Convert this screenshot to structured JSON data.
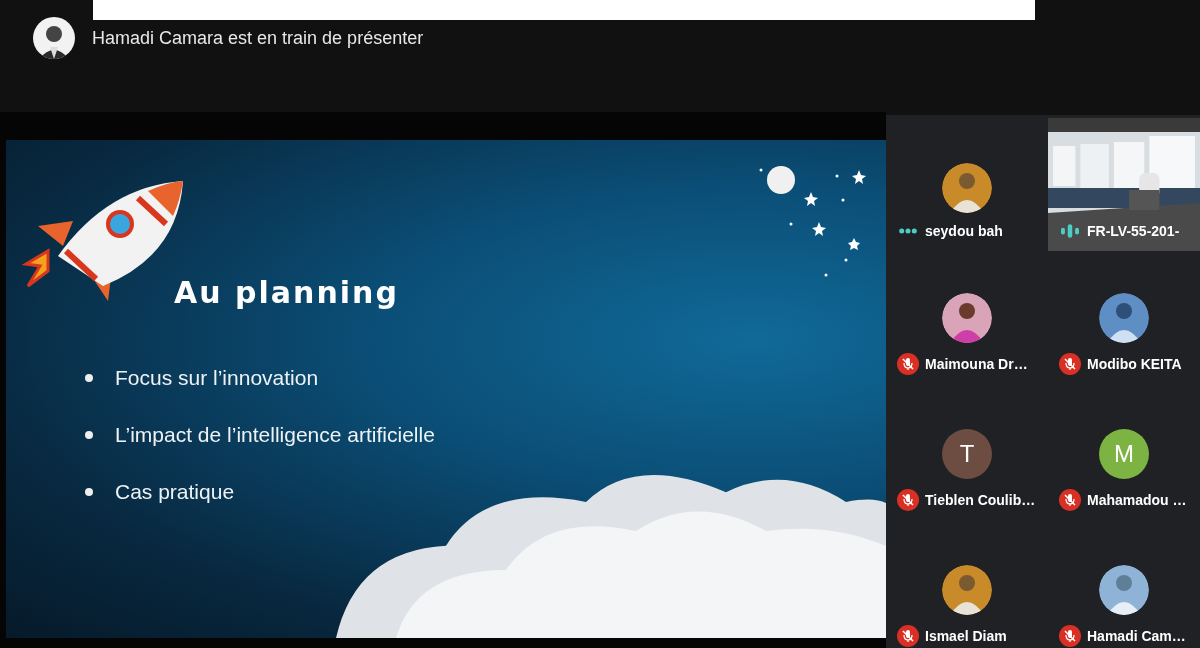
{
  "presenter_banner": {
    "text": "Hamadi Camara est en train de présenter"
  },
  "slide": {
    "title": "Au planning",
    "bullets": [
      "Focus sur l’innovation",
      "L’impact de l’intelligence artificielle",
      "Cas pratique"
    ]
  },
  "participants": [
    {
      "name": "seydou bah",
      "audio": {
        "kind": "dots"
      }
    },
    {
      "name": "FR-LV-55-201-",
      "audio": {
        "kind": "level"
      },
      "avatar": {
        "kind": "video"
      }
    },
    {
      "name": "Maimouna Dr…",
      "audio": {
        "kind": "muted"
      }
    },
    {
      "name": "Modibo KEITA",
      "audio": {
        "kind": "muted"
      }
    },
    {
      "name": "Tieblen Coulib…",
      "audio": {
        "kind": "muted"
      },
      "avatar": {
        "kind": "initial",
        "initial": "T",
        "color": "#6d4c41"
      }
    },
    {
      "name": "Mahamadou …",
      "audio": {
        "kind": "muted"
      },
      "avatar": {
        "kind": "initial",
        "initial": "M",
        "color": "#7cb342"
      }
    },
    {
      "name": "Ismael Diam",
      "audio": {
        "kind": "muted"
      }
    },
    {
      "name": "Hamadi Cam…",
      "audio": {
        "kind": "muted"
      }
    }
  ]
}
